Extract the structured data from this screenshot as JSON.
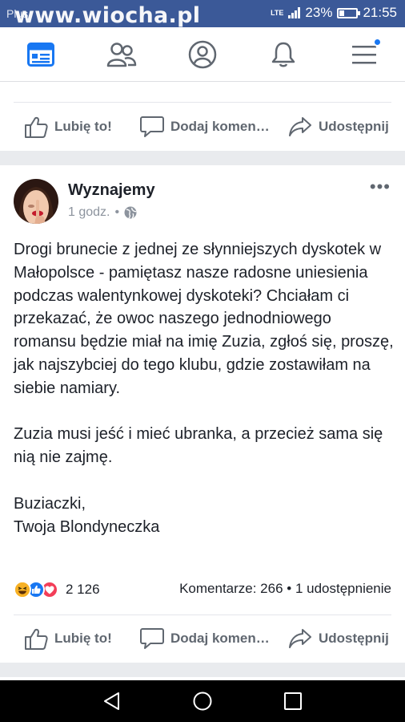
{
  "status_bar": {
    "carrier": "Plus",
    "watermark": "www.wiocha.pl",
    "network": "LTE",
    "battery_percent": "23%",
    "battery_level": 0.23,
    "time": "21:55"
  },
  "nav": {
    "tabs": [
      "news-feed",
      "friends",
      "profile",
      "notifications",
      "menu"
    ],
    "active": "news-feed",
    "accent_color": "#3b5998",
    "notification_dot_color": "#1877f2"
  },
  "previous_post": {
    "actions": {
      "like": "Lubię to!",
      "comment": "Dodaj komen…",
      "share": "Udostępnij"
    }
  },
  "post": {
    "page_name": "Wyznajemy",
    "time": "1 godz.",
    "separator": "•",
    "privacy_icon": "globe-icon",
    "more": "•••",
    "paragraphs": [
      "Drogi brunecie z jednej ze słynniejszych dyskotek w Małopolsce - pamiętasz nasze radosne uniesienia podczas walentynkowej dyskoteki? Chciałam ci przekazać, że owoc naszego jednodniowego romansu będzie miał na imię Zuzia, zgłoś się, proszę, jak najszybciej do tego klubu, gdzie zostawiłam na siebie namiary.",
      "Zuzia musi jeść i mieć ubranka, a przecież sama się nią nie zajmę.",
      "Buziaczki,\nTwoja Blondyneczka"
    ],
    "reactions": {
      "icons": [
        "haha-icon",
        "like-icon",
        "love-icon"
      ],
      "count": "2 126"
    },
    "summary": "Komentarze: 266 • 1 udostępnienie",
    "actions": {
      "like": "Lubię to!",
      "comment": "Dodaj komen…",
      "share": "Udostępnij"
    }
  },
  "system_nav": [
    "back",
    "home",
    "recents"
  ]
}
